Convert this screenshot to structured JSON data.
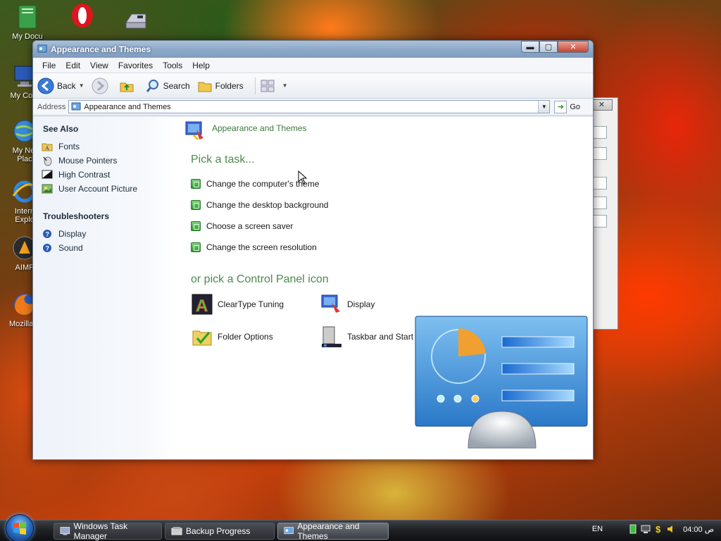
{
  "desktop": {
    "icons": [
      {
        "label": "My Docu",
        "icon": "documents-icon"
      },
      {
        "label": "",
        "icon": "opera-icon"
      },
      {
        "label": "",
        "icon": "drive-icon"
      },
      {
        "label": "My Com",
        "icon": "computer-icon"
      },
      {
        "label": "My Net",
        "label2": "Plac",
        "icon": "network-icon"
      },
      {
        "label": "Intern",
        "label2": "Explo",
        "icon": "internet-explorer-icon"
      },
      {
        "label": "AIMP",
        "icon": "aimp-icon"
      },
      {
        "label": "Mozilla F",
        "icon": "firefox-icon"
      }
    ]
  },
  "window": {
    "title": "Appearance and Themes",
    "menu": [
      "File",
      "Edit",
      "View",
      "Favorites",
      "Tools",
      "Help"
    ],
    "toolbar": {
      "back_label": "Back",
      "search_label": "Search",
      "folders_label": "Folders"
    },
    "address": {
      "label": "Address",
      "value": "Appearance and Themes",
      "go_label": "Go"
    },
    "sidebar": {
      "see_also_heading": "See Also",
      "see_also": [
        {
          "label": "Fonts",
          "icon": "fonts-folder-icon"
        },
        {
          "label": "Mouse Pointers",
          "icon": "mouse-pointer-icon"
        },
        {
          "label": "High Contrast",
          "icon": "high-contrast-icon"
        },
        {
          "label": "User Account Picture",
          "icon": "user-picture-icon"
        }
      ],
      "troubleshooters_heading": "Troubleshooters",
      "troubleshooters": [
        {
          "label": "Display",
          "icon": "help-icon"
        },
        {
          "label": "Sound",
          "icon": "help-icon"
        }
      ]
    },
    "main": {
      "category_title": "Appearance and Themes",
      "task_heading": "Pick a task...",
      "tasks": [
        "Change the computer's theme",
        "Change the desktop background",
        "Choose a screen saver",
        "Change the screen resolution"
      ],
      "icon_heading": "or pick a Control Panel icon",
      "icons": [
        {
          "label": "ClearType Tuning",
          "icon": "cleartype-icon"
        },
        {
          "label": "Display",
          "icon": "display-icon"
        },
        {
          "label": "Folder Options",
          "icon": "folder-options-icon"
        },
        {
          "label": "Taskbar and Start Menu",
          "icon": "taskbar-start-menu-icon"
        }
      ]
    }
  },
  "taskbar": {
    "buttons": [
      {
        "label": "Windows Task Manager"
      },
      {
        "label": "Backup Progress"
      },
      {
        "label": "Appearance and Themes"
      }
    ],
    "lang": "EN",
    "clock": "04:00 ص"
  },
  "colors": {
    "accent_green": "#4d8a4d",
    "titlebar": "#8ea9c8"
  }
}
